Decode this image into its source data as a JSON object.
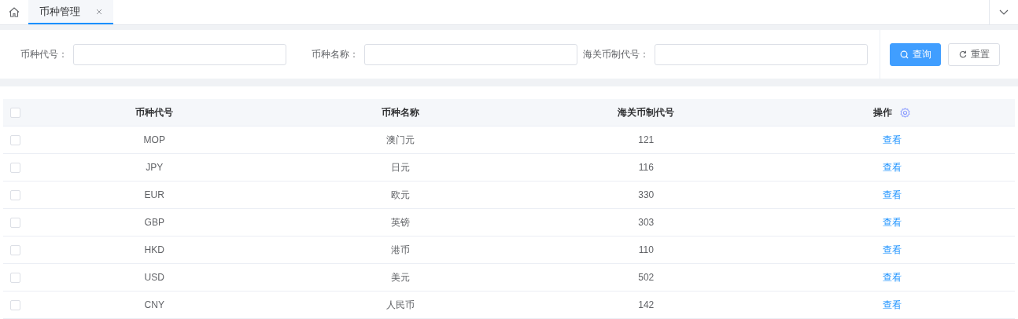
{
  "tabs": [
    {
      "label": "币种管理",
      "selected": true
    }
  ],
  "filters": [
    {
      "label": "币种代号："
    },
    {
      "label": "币种名称："
    },
    {
      "label": "海关币制代号："
    }
  ],
  "buttons": [
    {
      "kind": "search",
      "label": "查询"
    },
    {
      "kind": "reset",
      "label": "重置"
    }
  ],
  "table": {
    "select_all_checked": false,
    "columns": [
      "币种代号",
      "币种名称",
      "海关币制代号",
      "操作"
    ],
    "rows": [
      {
        "checked": false,
        "cells": [
          "MOP",
          "澳门元",
          "121"
        ],
        "action": "查看"
      },
      {
        "checked": false,
        "cells": [
          "JPY",
          "日元",
          "116"
        ],
        "action": "查看"
      },
      {
        "checked": false,
        "cells": [
          "EUR",
          "欧元",
          "330"
        ],
        "action": "查看"
      },
      {
        "checked": false,
        "cells": [
          "GBP",
          "英镑",
          "303"
        ],
        "action": "查看"
      },
      {
        "checked": false,
        "cells": [
          "HKD",
          "港币",
          "110"
        ],
        "action": "查看"
      },
      {
        "checked": false,
        "cells": [
          "USD",
          "美元",
          "502"
        ],
        "action": "查看"
      },
      {
        "checked": false,
        "cells": [
          "CNY",
          "人民币",
          "142"
        ],
        "action": "查看"
      }
    ]
  }
}
